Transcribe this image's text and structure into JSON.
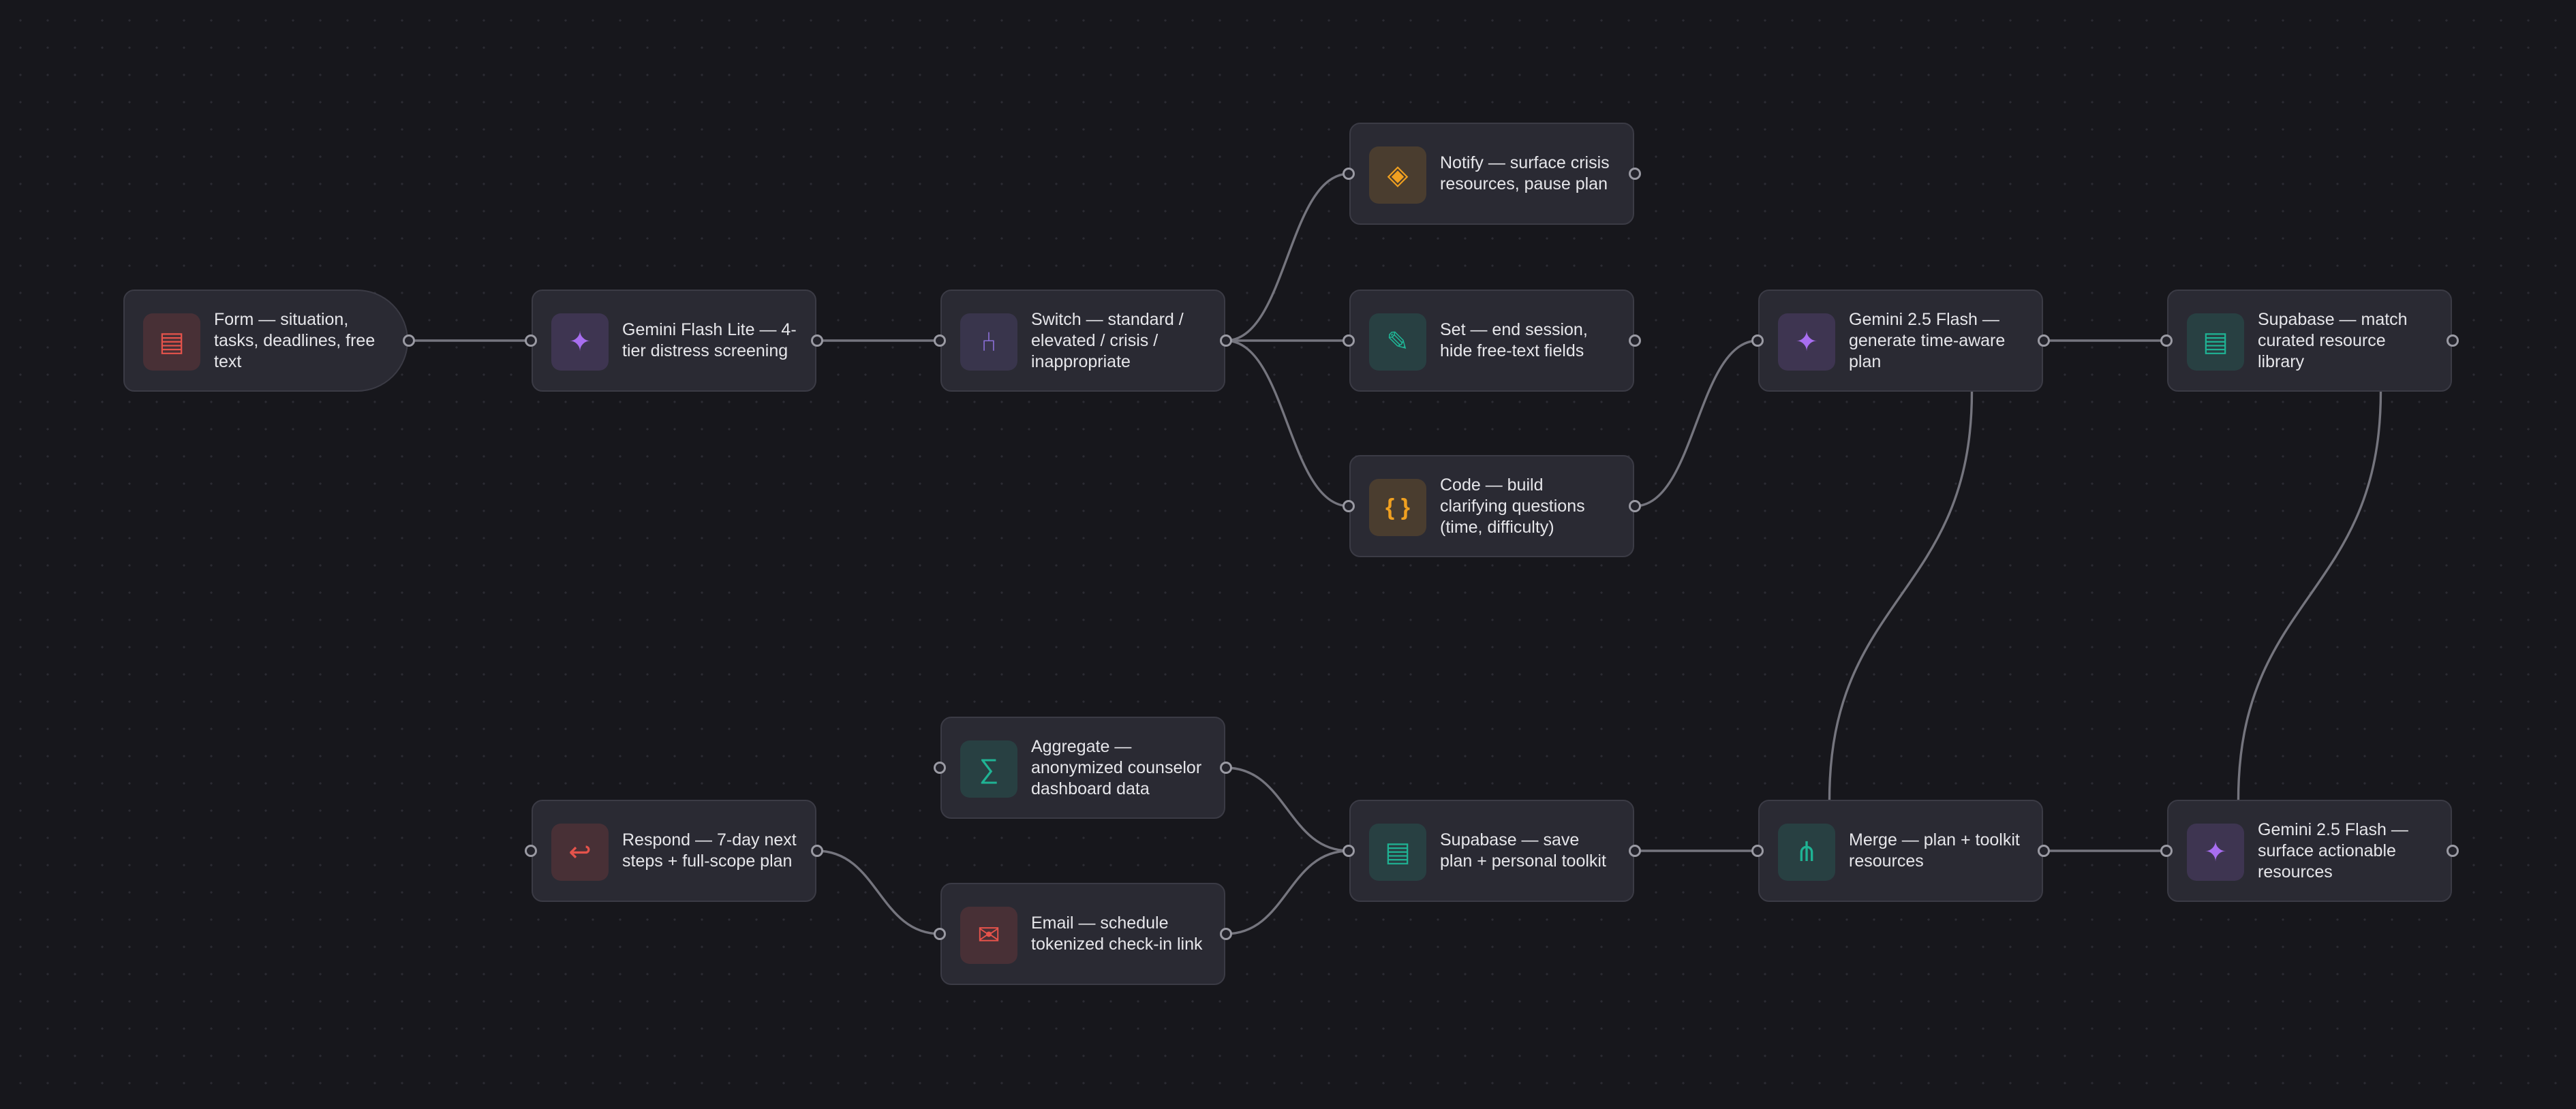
{
  "colors": {
    "background": "#17171c",
    "node_fill": "#2a2a33",
    "node_border": "#3b3b45",
    "edge": "#75757e",
    "red": "#e5534b",
    "purple": "#a86ef0",
    "teal": "#1fb394",
    "orange": "#f0a020",
    "indigo": "#8a6fd6"
  },
  "nodes": [
    {
      "id": "form",
      "label": "Form — situation, tasks, deadlines, free text",
      "icon": "form-icon",
      "color": "red",
      "glyph": "▤"
    },
    {
      "id": "screen",
      "label": "Gemini Flash Lite — 4-tier distress screening",
      "icon": "sparkle-icon",
      "color": "purple",
      "glyph": "✦"
    },
    {
      "id": "switch",
      "label": "Switch — standard / elevated / crisis / inappropriate",
      "icon": "switch-branch-icon",
      "color": "indigo",
      "glyph": "⑃"
    },
    {
      "id": "notify",
      "label": "Notify — surface crisis resources, pause plan",
      "icon": "alert-diamond-icon",
      "color": "orange",
      "glyph": "◈"
    },
    {
      "id": "set",
      "label": "Set — end session, hide free-text fields",
      "icon": "pencil-icon",
      "color": "teal",
      "glyph": "✎"
    },
    {
      "id": "code",
      "label": "Code — build clarifying questions (time, difficulty)",
      "icon": "code-braces-icon",
      "color": "orange",
      "glyph": "{ }"
    },
    {
      "id": "plan",
      "label": "Gemini 2.5 Flash — generate time-aware plan",
      "icon": "sparkle-icon",
      "color": "purple",
      "glyph": "✦"
    },
    {
      "id": "match",
      "label": "Supabase — match curated resource library",
      "icon": "database-icon",
      "color": "teal",
      "glyph": "▤"
    },
    {
      "id": "aggregate",
      "label": "Aggregate — anonymized counselor dashboard data",
      "icon": "sigma-icon",
      "color": "teal",
      "glyph": "∑"
    },
    {
      "id": "respond",
      "label": "Respond — 7-day next steps + full-scope plan",
      "icon": "return-arrow-icon",
      "color": "red",
      "glyph": "↩"
    },
    {
      "id": "email",
      "label": "Email — schedule tokenized check-in link",
      "icon": "envelope-icon",
      "color": "red",
      "glyph": "✉"
    },
    {
      "id": "save",
      "label": "Supabase — save plan + personal toolkit",
      "icon": "database-icon",
      "color": "teal",
      "glyph": "▤"
    },
    {
      "id": "merge",
      "label": "Merge — plan + toolkit resources",
      "icon": "merge-icon",
      "color": "teal",
      "glyph": "⋔"
    },
    {
      "id": "surface",
      "label": "Gemini 2.5 Flash — surface actionable resources",
      "icon": "sparkle-icon",
      "color": "purple",
      "glyph": "✦"
    }
  ],
  "edges": [
    [
      "form",
      "screen"
    ],
    [
      "screen",
      "switch"
    ],
    [
      "switch",
      "notify"
    ],
    [
      "switch",
      "set"
    ],
    [
      "switch",
      "code"
    ],
    [
      "code",
      "plan"
    ],
    [
      "plan",
      "match"
    ],
    [
      "plan",
      "merge"
    ],
    [
      "match",
      "surface"
    ],
    [
      "merge",
      "surface"
    ],
    [
      "save",
      "merge"
    ],
    [
      "aggregate",
      "save"
    ],
    [
      "email",
      "save"
    ],
    [
      "respond",
      "email"
    ]
  ]
}
